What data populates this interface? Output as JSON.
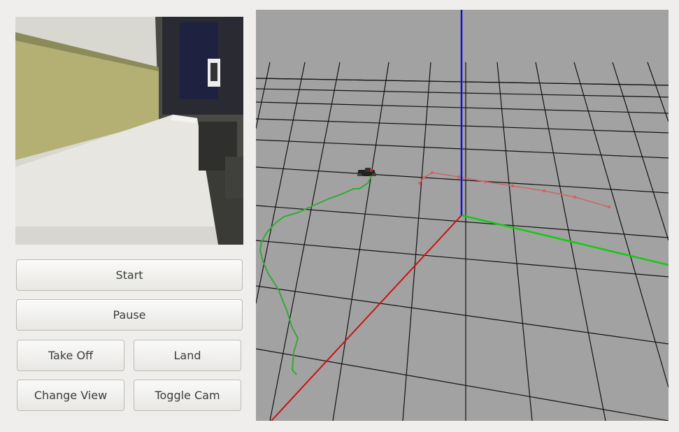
{
  "controls": {
    "start_label": "Start",
    "pause_label": "Pause",
    "takeoff_label": "Take Off",
    "land_label": "Land",
    "change_view_label": "Change View",
    "toggle_cam_label": "Toggle Cam"
  },
  "scene": {
    "background_color": "#a2a2a2",
    "grid_color": "#111111",
    "axis_x_color": "#cc1111",
    "axis_y_color": "#11cc11",
    "axis_z_color": "#1111dd",
    "trajectory_color": "#33aa33",
    "target_path_color": "#cc6666",
    "drone_icon": "quadcopter-model"
  }
}
